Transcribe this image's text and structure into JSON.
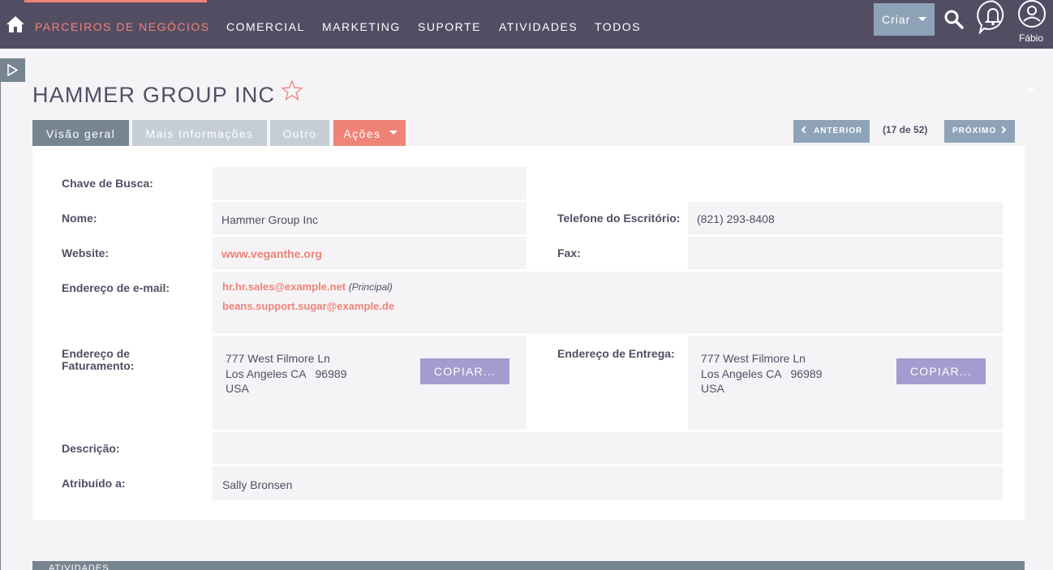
{
  "nav": {
    "items": [
      "PARCEIROS DE NEGÓCIOS",
      "COMERCIAL",
      "MARKETING",
      "SUPORTE",
      "ATIVIDADES",
      "TODOS"
    ],
    "active_index": 0,
    "create_label": "Criar",
    "user_name": "Fábio",
    "icons": [
      "home-icon",
      "search-icon",
      "bell-icon",
      "user-icon"
    ]
  },
  "record": {
    "title": "HAMMER GROUP INC"
  },
  "tabs": [
    "Visão geral",
    "Mais Informações",
    "Outro",
    "Ações"
  ],
  "pagination": {
    "prev_label": "ANTERIOR",
    "next_label": "PRÓXIMO",
    "count": "(17 de 52)"
  },
  "fields": {
    "search_key": {
      "label": "Chave de Busca:",
      "value": ""
    },
    "name": {
      "label": "Nome:",
      "value": "Hammer Group Inc"
    },
    "office_phone": {
      "label": "Telefone do Escritório:",
      "value": "(821) 293-8408"
    },
    "website": {
      "label": "Website:",
      "value": "www.veganthe.org"
    },
    "fax": {
      "label": "Fax:",
      "value": ""
    },
    "email": {
      "label": "Endereço de e-mail:",
      "primary": "hr.hr.sales@example.net",
      "primary_tag": "(Principal)",
      "secondary": "beans.support.sugar@example.de"
    },
    "billing": {
      "label": "Endereço de Faturamento:",
      "line1": "777 West Filmore Ln",
      "line2": "Los Angeles CA   96989",
      "line3": "USA",
      "copy_label": "COPIAR..."
    },
    "shipping": {
      "label": "Endereço de Entrega:",
      "line1": "777 West Filmore Ln",
      "line2": "Los Angeles CA   96989",
      "line3": "USA",
      "copy_label": "COPIAR..."
    },
    "description": {
      "label": "Descrição:",
      "value": ""
    },
    "assigned": {
      "label": "Atribuído a:",
      "value": "Sally Bronsen"
    }
  },
  "subpanel": {
    "title": "ATIVIDADES"
  },
  "colors": {
    "navbar": "#534d64",
    "accent": "#f08377",
    "tab_active": "#778591",
    "tab_inactive": "#c5cdd5",
    "button_blue": "#8ea3b8",
    "copy_button": "#a59bce",
    "field_bg": "#f5f3f6"
  }
}
